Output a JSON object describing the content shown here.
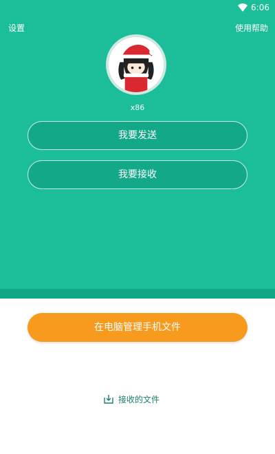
{
  "status_bar": {
    "time": "6:06",
    "wifi_icon": "wifi-icon"
  },
  "header": {
    "settings_label": "设置",
    "help_label": "使用帮助"
  },
  "profile": {
    "device_name": "x86",
    "avatar_icon": "avatar-image"
  },
  "actions": {
    "send_label": "我要发送",
    "receive_label": "我要接收",
    "manage_label": "在电脑管理手机文件",
    "received_files_label": "接收的文件",
    "received_files_icon": "download-tray-icon"
  },
  "colors": {
    "primary": "#1bbe98",
    "primary_dark": "#10a786",
    "accent": "#f79a1e",
    "link": "#1a7f6a",
    "background": "#ffffff"
  }
}
